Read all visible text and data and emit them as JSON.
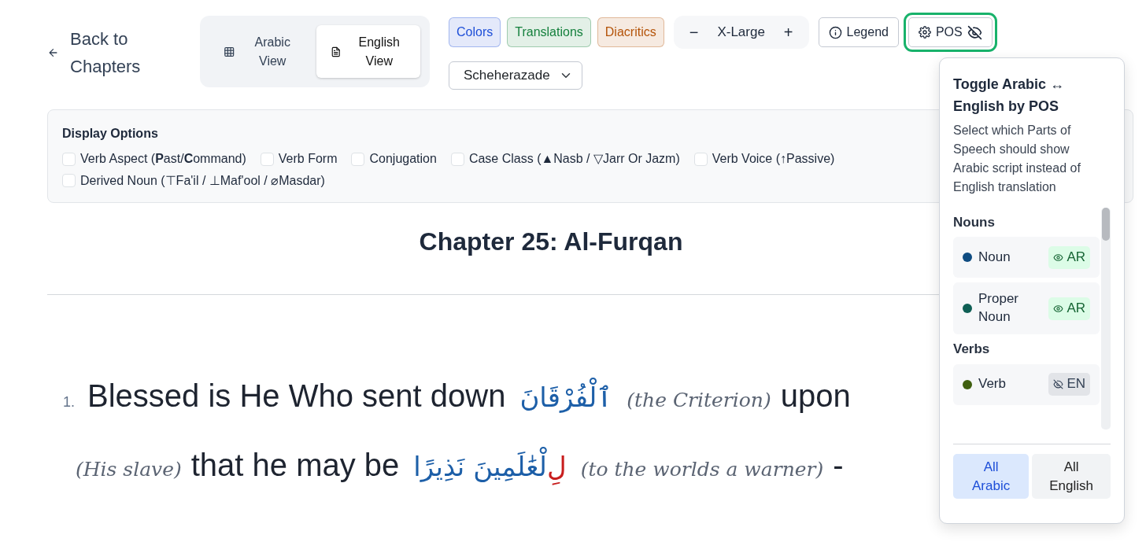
{
  "back_link": {
    "label": "Back to Chapters"
  },
  "view_toggle": [
    {
      "label": "Arabic View",
      "kind": "grid",
      "selected": false
    },
    {
      "label": "English View",
      "kind": "document",
      "selected": true
    }
  ],
  "feature_toggles": [
    {
      "label": "Colors",
      "color": "#1d4ed8"
    },
    {
      "label": "Translations",
      "color": "#15803d"
    },
    {
      "label": "Diacritics",
      "color": "#b45309"
    }
  ],
  "font_size": {
    "decrease": "−",
    "value": "X-Large",
    "increase": "+"
  },
  "legend_button": {
    "label": "Legend"
  },
  "pos_button": {
    "label": "POS",
    "active": true
  },
  "font_select": {
    "value": "Scheherazade"
  },
  "display_options": {
    "title": "Display Options",
    "options": [
      {
        "label": "Verb Aspect (**P**ast/**C**ommand)",
        "checked": false
      },
      {
        "label": "Verb Form",
        "checked": false
      },
      {
        "label": "Conjugation",
        "checked": false
      },
      {
        "label": "Case Class (▲Nasb / ▽Jarr Or Jazm)",
        "checked": false
      },
      {
        "label": "Verb Voice (↑Passive)",
        "checked": false
      },
      {
        "label": "Derived Noun (⊤Fa'il / ⊥Maf'ool / ⌀Masdar)",
        "checked": false
      }
    ]
  },
  "chapter_title": "Chapter 25: Al-Furqan",
  "verses": [
    {
      "number": "1.",
      "lines": [
        [
          {
            "kind": "english",
            "text": "Blessed is He Who sent down"
          },
          {
            "kind": "arabic",
            "parts": [
              {
                "text": "ٱلْفُرْقَانَ",
                "color": "#1d5fa8"
              }
            ]
          },
          {
            "kind": "gloss",
            "text": "(the Criterion)"
          },
          {
            "kind": "english",
            "text": "upon"
          }
        ],
        [
          {
            "kind": "gloss",
            "text": "(His slave)"
          },
          {
            "kind": "english",
            "text": "that he may be"
          },
          {
            "kind": "arabic",
            "parts": [
              {
                "text": "لِ",
                "color": "#c81e1e"
              },
              {
                "text": "لْعَٰلَمِينَ نَذِيرًا",
                "color": "#1d5fa8"
              }
            ]
          },
          {
            "kind": "gloss",
            "text": "(to the worlds a warner)"
          },
          {
            "kind": "english",
            "text": "-"
          }
        ]
      ]
    }
  ],
  "pos_popup": {
    "title": "Toggle Arabic ↔ English by POS",
    "description": "Select which Parts of Speech should show Arabic script instead of English translation",
    "groups": [
      {
        "name": "Nouns",
        "items": [
          {
            "label": "Noun",
            "color": "#0f4c81",
            "mode": "AR"
          },
          {
            "label": "Proper Noun",
            "color": "#0f5f55",
            "mode": "AR"
          }
        ]
      },
      {
        "name": "Verbs",
        "items": [
          {
            "label": "Verb",
            "color": "#3f5f0f",
            "mode": "EN"
          }
        ]
      }
    ],
    "buttons": [
      {
        "label": "All Arabic",
        "selected": true
      },
      {
        "label": "All English",
        "selected": false
      }
    ]
  }
}
